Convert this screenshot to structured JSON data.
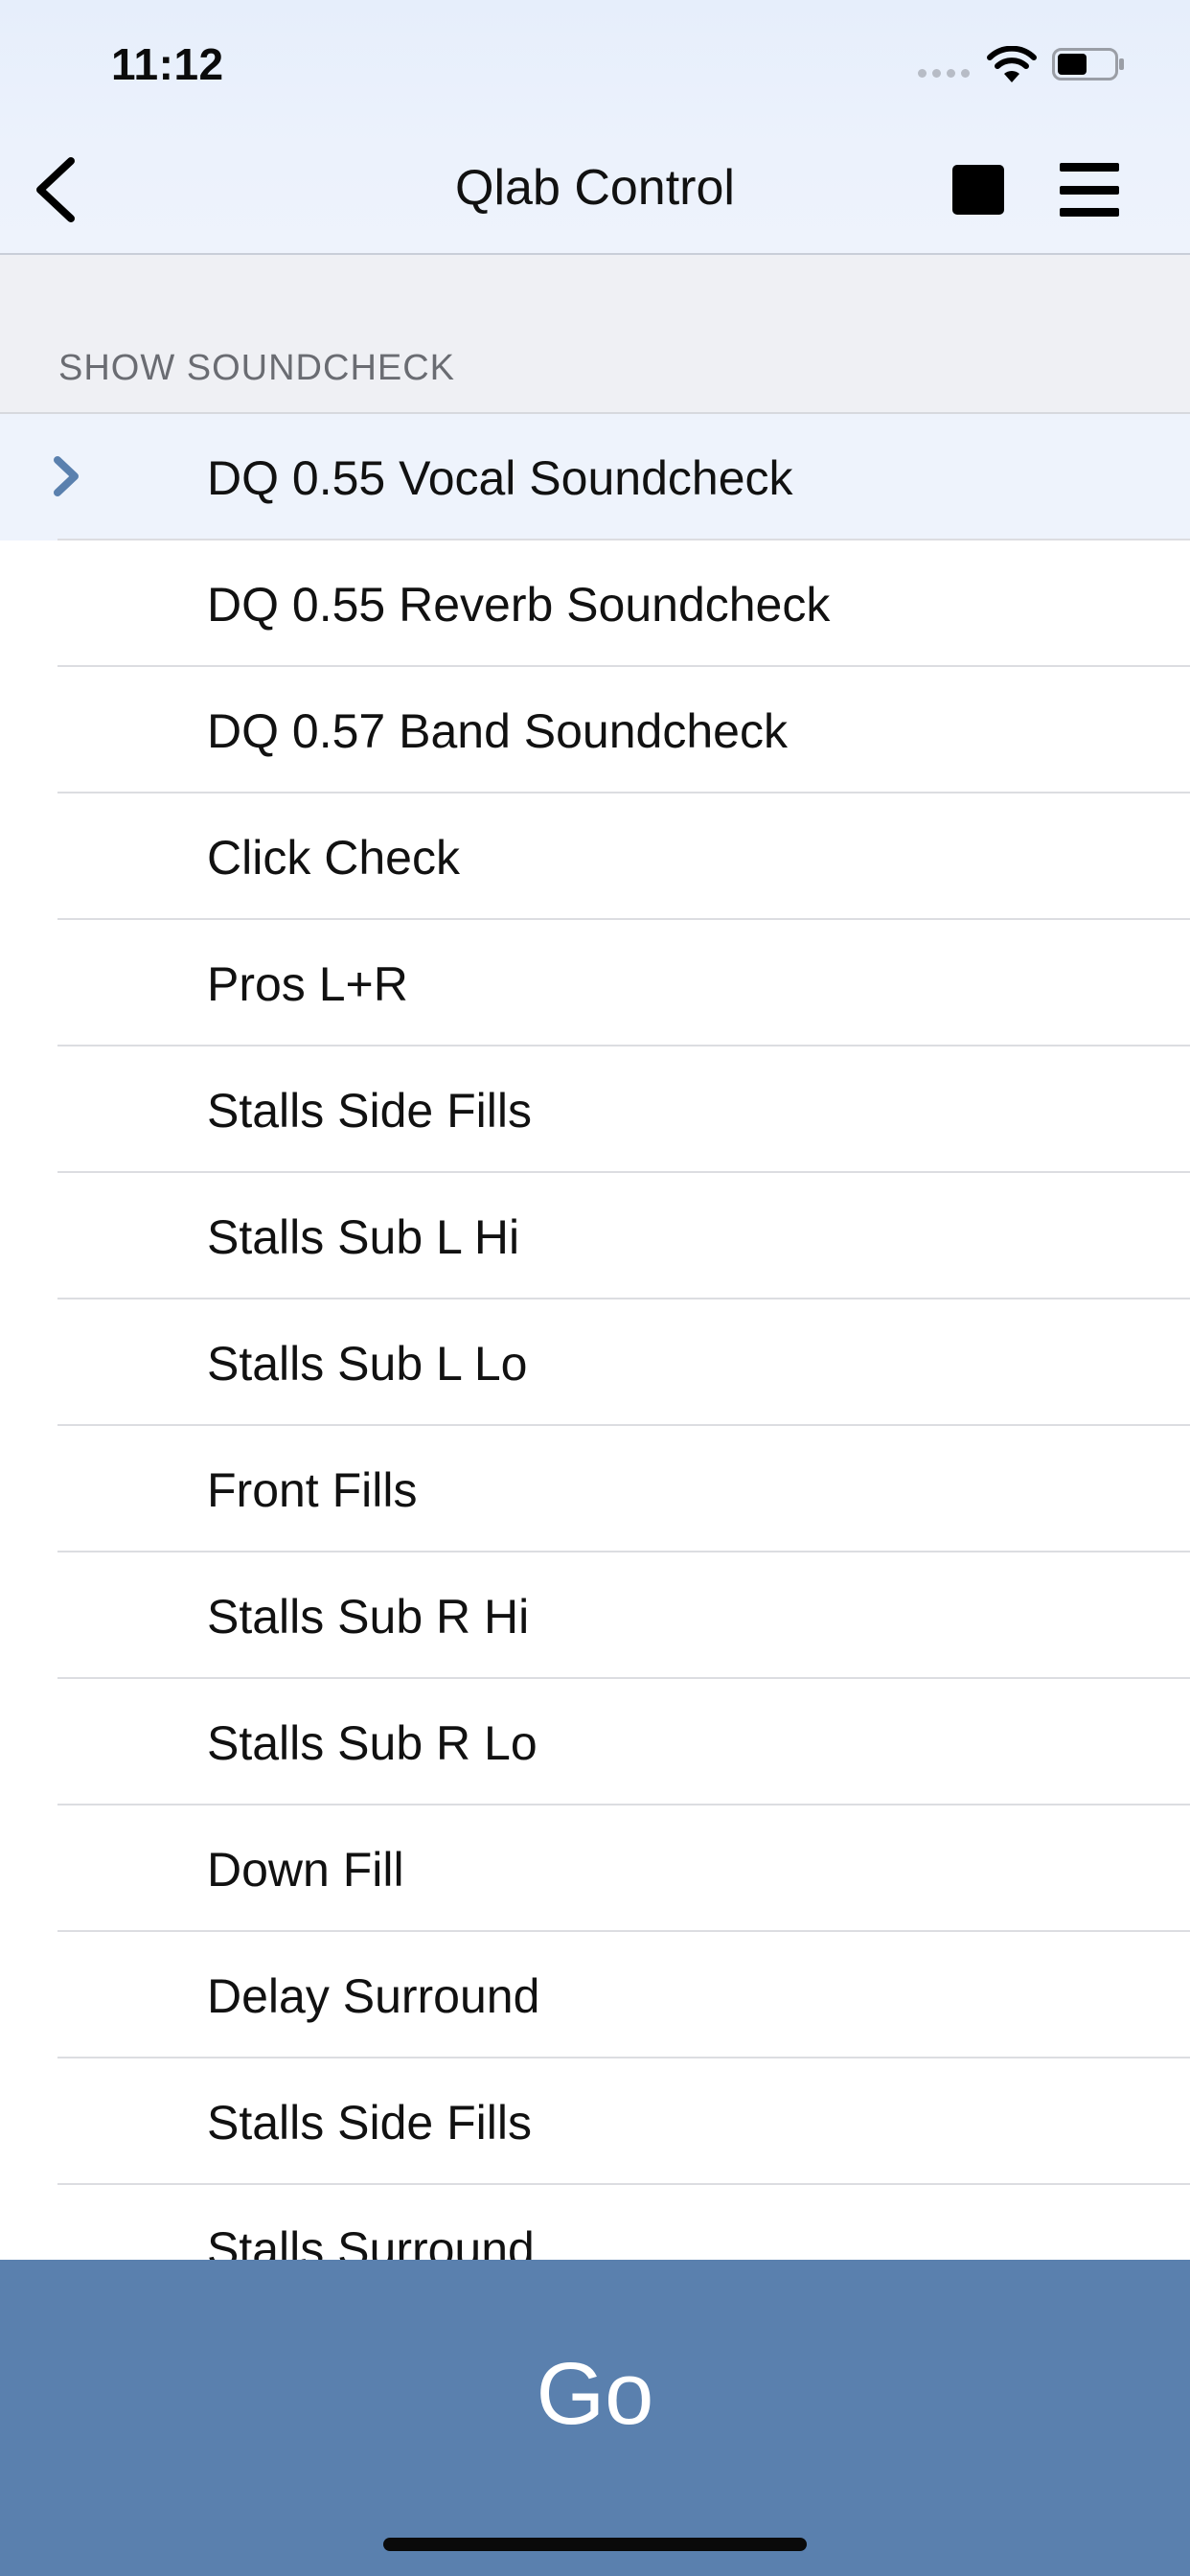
{
  "status_bar": {
    "time": "11:12"
  },
  "nav": {
    "title": "Qlab Control"
  },
  "section": {
    "title": "SHOW SOUNDCHECK"
  },
  "cues": [
    {
      "label": "DQ 0.55 Vocal Soundcheck",
      "active": true
    },
    {
      "label": "DQ 0.55 Reverb Soundcheck",
      "active": false
    },
    {
      "label": "DQ 0.57 Band Soundcheck",
      "active": false
    },
    {
      "label": "Click Check",
      "active": false
    },
    {
      "label": "Pros L+R",
      "active": false
    },
    {
      "label": "Stalls Side Fills",
      "active": false
    },
    {
      "label": "Stalls Sub L Hi",
      "active": false
    },
    {
      "label": "Stalls Sub L Lo",
      "active": false
    },
    {
      "label": "Front Fills",
      "active": false
    },
    {
      "label": "Stalls Sub R Hi",
      "active": false
    },
    {
      "label": "Stalls Sub R Lo",
      "active": false
    },
    {
      "label": "Down Fill",
      "active": false
    },
    {
      "label": "Delay Surround",
      "active": false
    },
    {
      "label": "Stalls Side Fills",
      "active": false
    },
    {
      "label": "Stalls Surround",
      "active": false
    }
  ],
  "go_button": {
    "label": "Go"
  },
  "colors": {
    "go_button": "#5a80ae",
    "active_chevron": "#5a80ae",
    "active_row": "#eef3fc"
  },
  "icons": {
    "back": "chevron-left-icon",
    "stop": "stop-square-icon",
    "menu": "hamburger-menu-icon",
    "active_cue": "chevron-right-icon"
  }
}
